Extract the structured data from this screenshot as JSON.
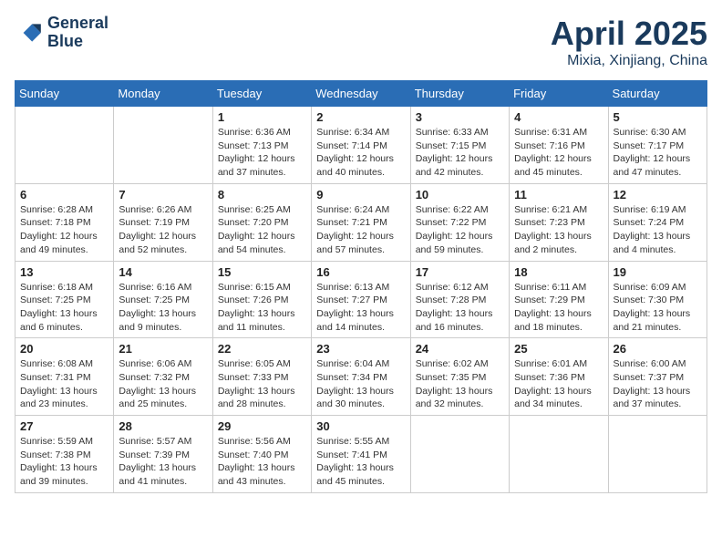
{
  "header": {
    "logo_line1": "General",
    "logo_line2": "Blue",
    "month_title": "April 2025",
    "location": "Mixia, Xinjiang, China"
  },
  "weekdays": [
    "Sunday",
    "Monday",
    "Tuesday",
    "Wednesday",
    "Thursday",
    "Friday",
    "Saturday"
  ],
  "weeks": [
    [
      {
        "day": "",
        "sunrise": "",
        "sunset": "",
        "daylight": ""
      },
      {
        "day": "",
        "sunrise": "",
        "sunset": "",
        "daylight": ""
      },
      {
        "day": "1",
        "sunrise": "Sunrise: 6:36 AM",
        "sunset": "Sunset: 7:13 PM",
        "daylight": "Daylight: 12 hours and 37 minutes."
      },
      {
        "day": "2",
        "sunrise": "Sunrise: 6:34 AM",
        "sunset": "Sunset: 7:14 PM",
        "daylight": "Daylight: 12 hours and 40 minutes."
      },
      {
        "day": "3",
        "sunrise": "Sunrise: 6:33 AM",
        "sunset": "Sunset: 7:15 PM",
        "daylight": "Daylight: 12 hours and 42 minutes."
      },
      {
        "day": "4",
        "sunrise": "Sunrise: 6:31 AM",
        "sunset": "Sunset: 7:16 PM",
        "daylight": "Daylight: 12 hours and 45 minutes."
      },
      {
        "day": "5",
        "sunrise": "Sunrise: 6:30 AM",
        "sunset": "Sunset: 7:17 PM",
        "daylight": "Daylight: 12 hours and 47 minutes."
      }
    ],
    [
      {
        "day": "6",
        "sunrise": "Sunrise: 6:28 AM",
        "sunset": "Sunset: 7:18 PM",
        "daylight": "Daylight: 12 hours and 49 minutes."
      },
      {
        "day": "7",
        "sunrise": "Sunrise: 6:26 AM",
        "sunset": "Sunset: 7:19 PM",
        "daylight": "Daylight: 12 hours and 52 minutes."
      },
      {
        "day": "8",
        "sunrise": "Sunrise: 6:25 AM",
        "sunset": "Sunset: 7:20 PM",
        "daylight": "Daylight: 12 hours and 54 minutes."
      },
      {
        "day": "9",
        "sunrise": "Sunrise: 6:24 AM",
        "sunset": "Sunset: 7:21 PM",
        "daylight": "Daylight: 12 hours and 57 minutes."
      },
      {
        "day": "10",
        "sunrise": "Sunrise: 6:22 AM",
        "sunset": "Sunset: 7:22 PM",
        "daylight": "Daylight: 12 hours and 59 minutes."
      },
      {
        "day": "11",
        "sunrise": "Sunrise: 6:21 AM",
        "sunset": "Sunset: 7:23 PM",
        "daylight": "Daylight: 13 hours and 2 minutes."
      },
      {
        "day": "12",
        "sunrise": "Sunrise: 6:19 AM",
        "sunset": "Sunset: 7:24 PM",
        "daylight": "Daylight: 13 hours and 4 minutes."
      }
    ],
    [
      {
        "day": "13",
        "sunrise": "Sunrise: 6:18 AM",
        "sunset": "Sunset: 7:25 PM",
        "daylight": "Daylight: 13 hours and 6 minutes."
      },
      {
        "day": "14",
        "sunrise": "Sunrise: 6:16 AM",
        "sunset": "Sunset: 7:25 PM",
        "daylight": "Daylight: 13 hours and 9 minutes."
      },
      {
        "day": "15",
        "sunrise": "Sunrise: 6:15 AM",
        "sunset": "Sunset: 7:26 PM",
        "daylight": "Daylight: 13 hours and 11 minutes."
      },
      {
        "day": "16",
        "sunrise": "Sunrise: 6:13 AM",
        "sunset": "Sunset: 7:27 PM",
        "daylight": "Daylight: 13 hours and 14 minutes."
      },
      {
        "day": "17",
        "sunrise": "Sunrise: 6:12 AM",
        "sunset": "Sunset: 7:28 PM",
        "daylight": "Daylight: 13 hours and 16 minutes."
      },
      {
        "day": "18",
        "sunrise": "Sunrise: 6:11 AM",
        "sunset": "Sunset: 7:29 PM",
        "daylight": "Daylight: 13 hours and 18 minutes."
      },
      {
        "day": "19",
        "sunrise": "Sunrise: 6:09 AM",
        "sunset": "Sunset: 7:30 PM",
        "daylight": "Daylight: 13 hours and 21 minutes."
      }
    ],
    [
      {
        "day": "20",
        "sunrise": "Sunrise: 6:08 AM",
        "sunset": "Sunset: 7:31 PM",
        "daylight": "Daylight: 13 hours and 23 minutes."
      },
      {
        "day": "21",
        "sunrise": "Sunrise: 6:06 AM",
        "sunset": "Sunset: 7:32 PM",
        "daylight": "Daylight: 13 hours and 25 minutes."
      },
      {
        "day": "22",
        "sunrise": "Sunrise: 6:05 AM",
        "sunset": "Sunset: 7:33 PM",
        "daylight": "Daylight: 13 hours and 28 minutes."
      },
      {
        "day": "23",
        "sunrise": "Sunrise: 6:04 AM",
        "sunset": "Sunset: 7:34 PM",
        "daylight": "Daylight: 13 hours and 30 minutes."
      },
      {
        "day": "24",
        "sunrise": "Sunrise: 6:02 AM",
        "sunset": "Sunset: 7:35 PM",
        "daylight": "Daylight: 13 hours and 32 minutes."
      },
      {
        "day": "25",
        "sunrise": "Sunrise: 6:01 AM",
        "sunset": "Sunset: 7:36 PM",
        "daylight": "Daylight: 13 hours and 34 minutes."
      },
      {
        "day": "26",
        "sunrise": "Sunrise: 6:00 AM",
        "sunset": "Sunset: 7:37 PM",
        "daylight": "Daylight: 13 hours and 37 minutes."
      }
    ],
    [
      {
        "day": "27",
        "sunrise": "Sunrise: 5:59 AM",
        "sunset": "Sunset: 7:38 PM",
        "daylight": "Daylight: 13 hours and 39 minutes."
      },
      {
        "day": "28",
        "sunrise": "Sunrise: 5:57 AM",
        "sunset": "Sunset: 7:39 PM",
        "daylight": "Daylight: 13 hours and 41 minutes."
      },
      {
        "day": "29",
        "sunrise": "Sunrise: 5:56 AM",
        "sunset": "Sunset: 7:40 PM",
        "daylight": "Daylight: 13 hours and 43 minutes."
      },
      {
        "day": "30",
        "sunrise": "Sunrise: 5:55 AM",
        "sunset": "Sunset: 7:41 PM",
        "daylight": "Daylight: 13 hours and 45 minutes."
      },
      {
        "day": "",
        "sunrise": "",
        "sunset": "",
        "daylight": ""
      },
      {
        "day": "",
        "sunrise": "",
        "sunset": "",
        "daylight": ""
      },
      {
        "day": "",
        "sunrise": "",
        "sunset": "",
        "daylight": ""
      }
    ]
  ]
}
